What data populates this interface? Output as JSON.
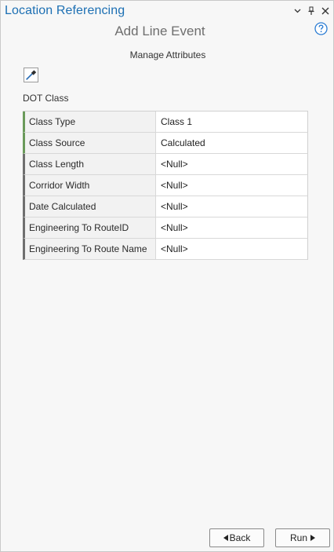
{
  "pane": {
    "title": "Location Referencing",
    "menu_icon": "chevron-down-icon",
    "pin_icon": "pin-icon",
    "close_icon": "close-icon"
  },
  "tool": {
    "name": "Add Line Event",
    "help_icon": "help-icon"
  },
  "section": {
    "title": "Manage Attributes",
    "picker_icon": "eyedropper-icon"
  },
  "attributes": {
    "group_label": "DOT Class",
    "rows": [
      {
        "name": "Class Type",
        "value": "Class 1",
        "required": true
      },
      {
        "name": "Class Source",
        "value": "Calculated",
        "required": true
      },
      {
        "name": "Class Length",
        "value": "<Null>",
        "required": false
      },
      {
        "name": "Corridor Width",
        "value": "<Null>",
        "required": false
      },
      {
        "name": "Date Calculated",
        "value": "<Null>",
        "required": false
      },
      {
        "name": "Engineering To RouteID",
        "value": "<Null>",
        "required": false
      },
      {
        "name": "Engineering To Route Name",
        "value": "<Null>",
        "required": false
      }
    ]
  },
  "footer": {
    "back_label": "Back",
    "run_label": "Run"
  },
  "colors": {
    "title_blue": "#1c6fb3",
    "required_indicator": "#6a9a5a",
    "optional_indicator": "#6f6f6f"
  }
}
